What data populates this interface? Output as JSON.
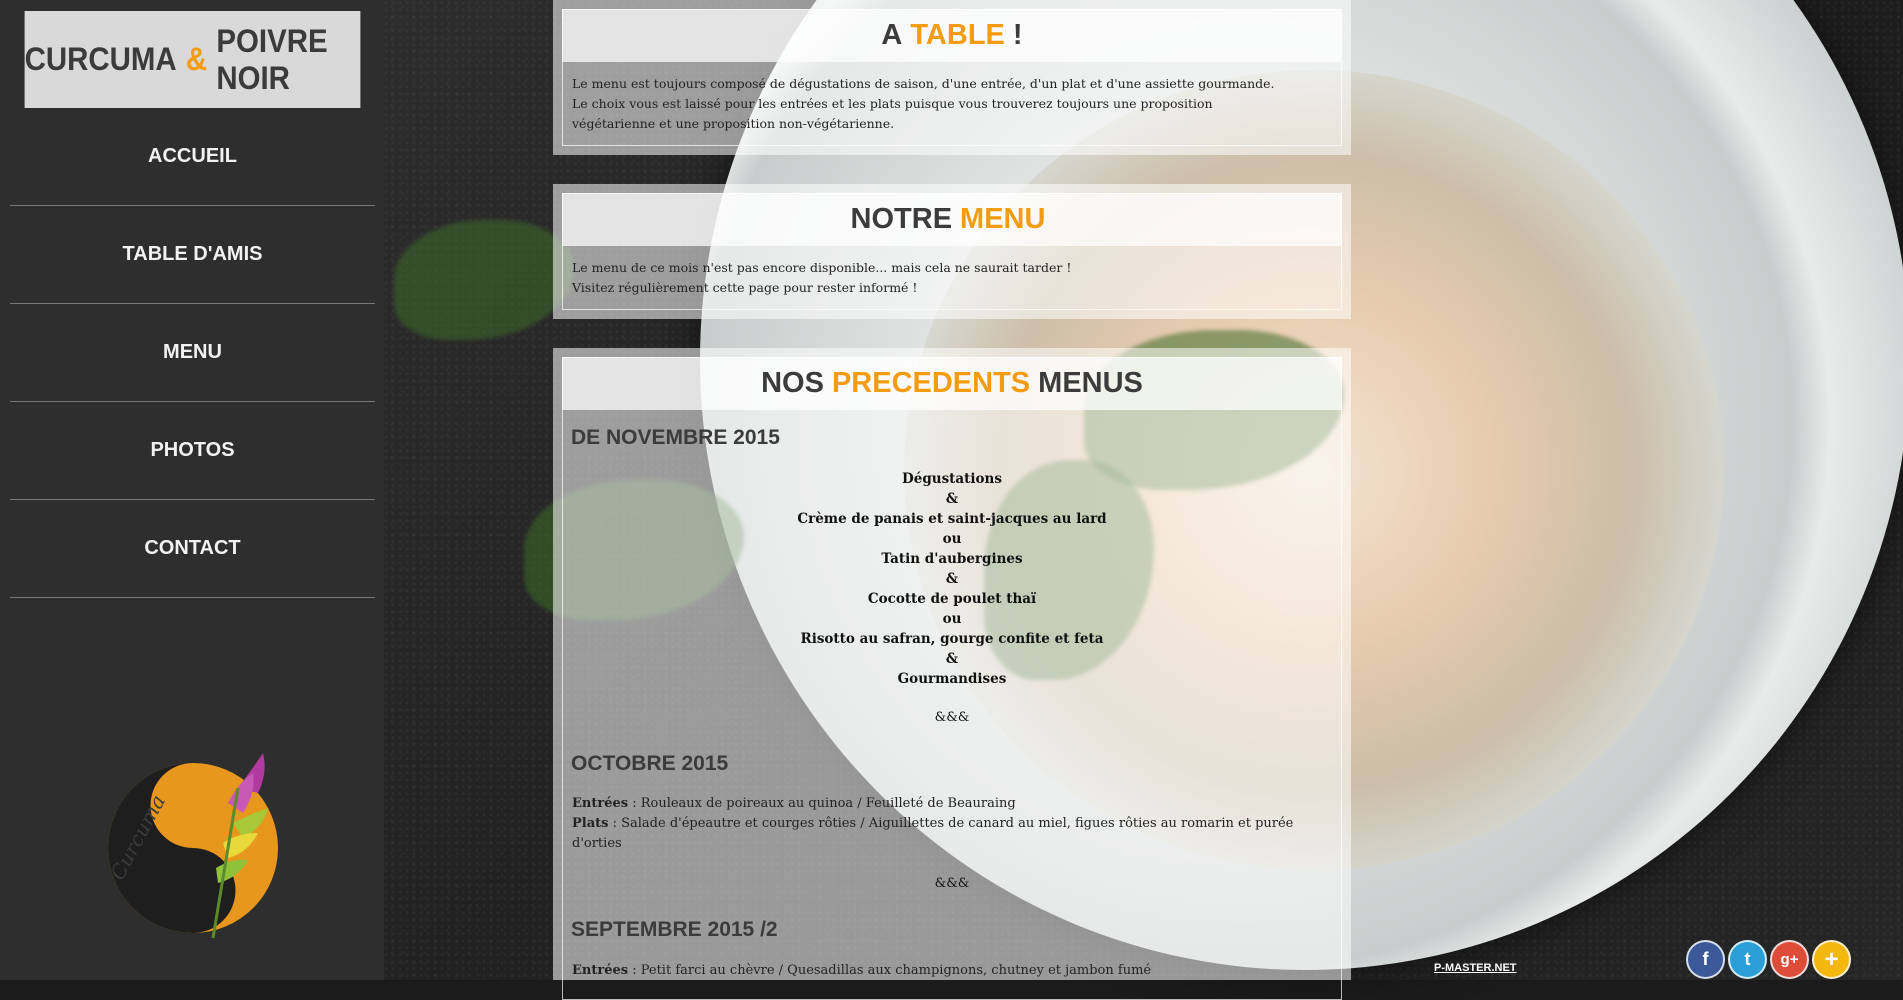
{
  "brand": {
    "part1": "CURCUMA",
    "amp": "&",
    "part2": "POIVRE NOIR"
  },
  "nav": {
    "items": [
      {
        "label": "ACCUEIL"
      },
      {
        "label": "TABLE D'AMIS"
      },
      {
        "label": "MENU"
      },
      {
        "label": "PHOTOS"
      },
      {
        "label": "CONTACT"
      }
    ]
  },
  "logo": {
    "text": "Curcuma & poivre noir"
  },
  "card1": {
    "title_a": "A",
    "title_hl": "TABLE",
    "title_b": "!",
    "lines": [
      "Le menu est toujours composé de dégustations de saison, d'une entrée, d'un plat et d'une assiette gourmande.",
      "Le choix vous est laissé pour les entrées et les plats puisque vous trouverez toujours une proposition",
      "végétarienne et une proposition non-végétarienne."
    ]
  },
  "card2": {
    "title_a": "NOTRE",
    "title_hl": "MENU",
    "lines": [
      "Le menu de ce mois n'est pas encore disponible... mais cela ne saurait tarder !",
      "Visitez régulièrement cette page pour rester informé !"
    ]
  },
  "card3": {
    "title_a": "NOS",
    "title_hl": "PRECEDENTS",
    "title_b": "MENUS",
    "nov": {
      "heading": "DE NOVEMBRE 2015",
      "lines": [
        "Dégustations",
        "&",
        "Crème de panais et saint-jacques au lard",
        "ou",
        "Tatin d'aubergines",
        "&",
        "Cocotte de poulet thaï",
        "ou",
        "Risotto au safran, gourge confite et feta",
        "&",
        "Gourmandises"
      ],
      "sep": "&&&"
    },
    "oct": {
      "heading": "OCTOBRE 2015",
      "entrees_label": "Entrées",
      "entrees": " : Rouleaux de poireaux au quinoa / Feuilleté de Beauraing",
      "plats_label": "Plats",
      "plats": " : Salade d'épeautre et courges rôties / Aiguillettes de canard au miel, figues rôties au romarin et purée d'orties",
      "sep": "&&&"
    },
    "sep": {
      "heading": "SEPTEMBRE 2015 /2",
      "entrees_label": "Entrées",
      "entrees": " : Petit farci au chèvre / Quesadillas aux champignons, chutney et jambon fumé"
    }
  },
  "footer": {
    "link": "P-MASTER.NET"
  },
  "social": [
    {
      "name": "facebook",
      "glyph": "f",
      "color": "#3b5998"
    },
    {
      "name": "twitter",
      "glyph": "t",
      "color": "#2a9fd6"
    },
    {
      "name": "google-plus",
      "glyph": "g+",
      "color": "#dd4b39"
    },
    {
      "name": "share-more",
      "glyph": "+",
      "color": "#f3b70d"
    }
  ]
}
